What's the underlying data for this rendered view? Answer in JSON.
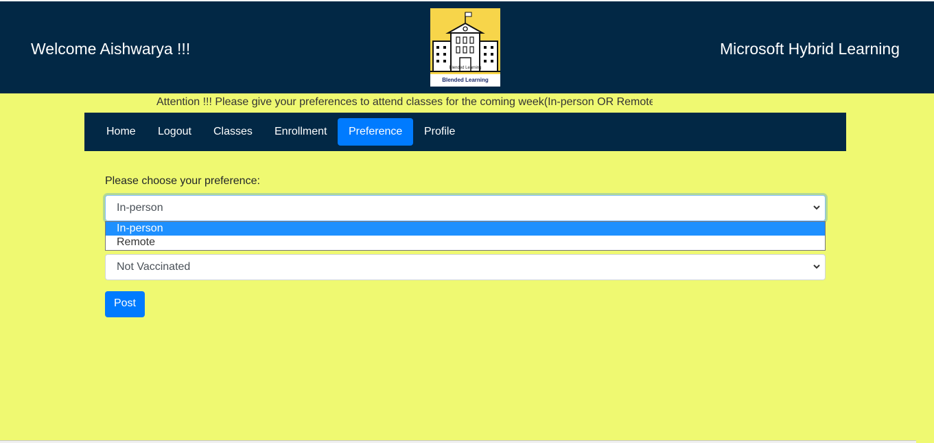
{
  "header": {
    "welcome": "Welcome Aishwarya !!!",
    "brand": "Microsoft Hybrid Learning",
    "logo": {
      "icon": "school-building-icon",
      "caption": "Blended Learning",
      "caption_small": "Blended Learning"
    }
  },
  "announcement": "Attention !!! Please give your preferences to attend classes for the coming week(In-person OR Remote",
  "nav": {
    "items": [
      {
        "label": "Home"
      },
      {
        "label": "Logout"
      },
      {
        "label": "Classes"
      },
      {
        "label": "Enrollment"
      },
      {
        "label": "Preference",
        "active": true
      },
      {
        "label": "Profile"
      }
    ]
  },
  "form": {
    "prompt": "Please choose your preference:",
    "preference": {
      "selected": "In-person",
      "options": [
        "In-person",
        "Remote"
      ],
      "highlighted": "In-person"
    },
    "vaccination": {
      "selected": "Not Vaccinated"
    },
    "submit_label": "Post"
  },
  "colors": {
    "header_bg": "#022845",
    "page_bg": "#eff971",
    "accent": "#007bff",
    "option_highlight": "#1e90ff"
  }
}
